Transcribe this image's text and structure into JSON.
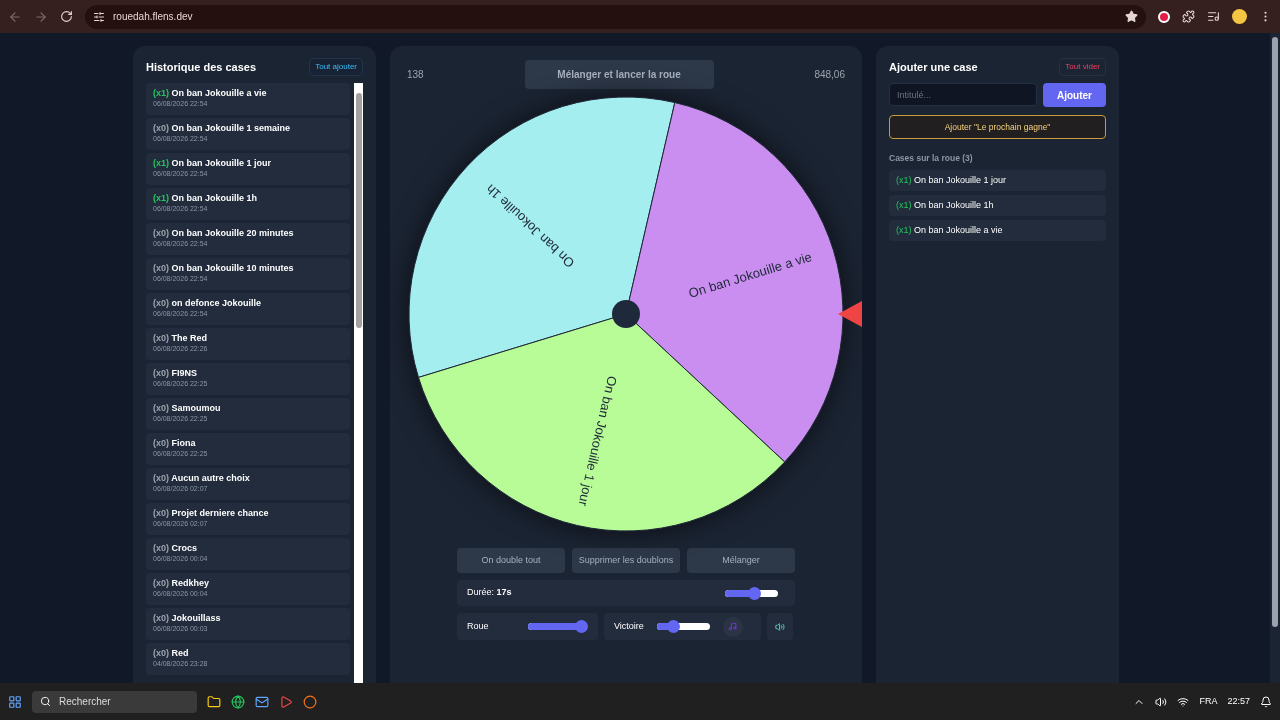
{
  "browser": {
    "url": "rouedah.flens.dev"
  },
  "history": {
    "title": "Historique des cases",
    "add_all": "Tout ajouter",
    "items": [
      {
        "count": "(x1)",
        "on_wheel": true,
        "name": "On ban Jokouille a vie",
        "date": "06/08/2026 22:54"
      },
      {
        "count": "(x0)",
        "on_wheel": false,
        "name": "On ban Jokouille 1 semaine",
        "date": "06/08/2026 22:54"
      },
      {
        "count": "(x1)",
        "on_wheel": true,
        "name": "On ban Jokouille 1 jour",
        "date": "06/08/2026 22:54"
      },
      {
        "count": "(x1)",
        "on_wheel": true,
        "name": "On ban Jokouille 1h",
        "date": "06/08/2026 22:54"
      },
      {
        "count": "(x0)",
        "on_wheel": false,
        "name": "On ban Jokouille 20 minutes",
        "date": "06/08/2026 22:54"
      },
      {
        "count": "(x0)",
        "on_wheel": false,
        "name": "On ban Jokouille 10 minutes",
        "date": "06/08/2026 22:54"
      },
      {
        "count": "(x0)",
        "on_wheel": false,
        "name": "on defonce Jokouille",
        "date": "06/08/2026 22:54"
      },
      {
        "count": "(x0)",
        "on_wheel": false,
        "name": "The Red",
        "date": "06/08/2026 22:26"
      },
      {
        "count": "(x0)",
        "on_wheel": false,
        "name": "FI9NS",
        "date": "06/08/2026 22:25"
      },
      {
        "count": "(x0)",
        "on_wheel": false,
        "name": "Samoumou",
        "date": "06/08/2026 22:25"
      },
      {
        "count": "(x0)",
        "on_wheel": false,
        "name": "Fiona",
        "date": "06/08/2026 22:25"
      },
      {
        "count": "(x0)",
        "on_wheel": false,
        "name": "Aucun autre choix",
        "date": "06/08/2026 02:07"
      },
      {
        "count": "(x0)",
        "on_wheel": false,
        "name": "Projet derniere chance",
        "date": "06/08/2026 02:07"
      },
      {
        "count": "(x0)",
        "on_wheel": false,
        "name": "Crocs",
        "date": "06/08/2026 00:04"
      },
      {
        "count": "(x0)",
        "on_wheel": false,
        "name": "Redkhey",
        "date": "06/08/2026 00:04"
      },
      {
        "count": "(x0)",
        "on_wheel": false,
        "name": "Jokouillass",
        "date": "06/08/2026 00:03"
      },
      {
        "count": "(x0)",
        "on_wheel": false,
        "name": "Red",
        "date": "04/08/2026 23:28"
      }
    ]
  },
  "wheel": {
    "left_stat": "138",
    "spin_button": "Mélanger et lancer la roue",
    "right_stat": "848,06",
    "segments": [
      {
        "label": "On ban Jokouille 1h",
        "color": "#a5eef0"
      },
      {
        "label": "On ban Jokouille a vie",
        "color": "#c98ef0"
      },
      {
        "label": "On ban Jokouille 1 jour",
        "color": "#b8fc98"
      }
    ],
    "actions": [
      "On double tout",
      "Supprimer les doublons",
      "Mélanger"
    ],
    "duration": {
      "label": "Durée:",
      "value": "17s",
      "level": 0.55
    },
    "wheel_volume": {
      "label": "Roue",
      "level": 1.0
    },
    "win_volume": {
      "label": "Victoire",
      "level": 0.3
    }
  },
  "add": {
    "title": "Ajouter une case",
    "clear": "Tout vider",
    "placeholder": "Intitulé...",
    "submit": "Ajouter",
    "next_wins": "Ajouter \"Le prochain gagne\"",
    "list_title": "Cases sur la roue (3)",
    "items": [
      {
        "count": "(x1)",
        "name": "On ban Jokouille 1 jour"
      },
      {
        "count": "(x1)",
        "name": "On ban Jokouille 1h"
      },
      {
        "count": "(x1)",
        "name": "On ban Jokouille a vie"
      }
    ]
  },
  "taskbar": {
    "search": "Rechercher",
    "language": "FRA",
    "time": "22:57"
  }
}
